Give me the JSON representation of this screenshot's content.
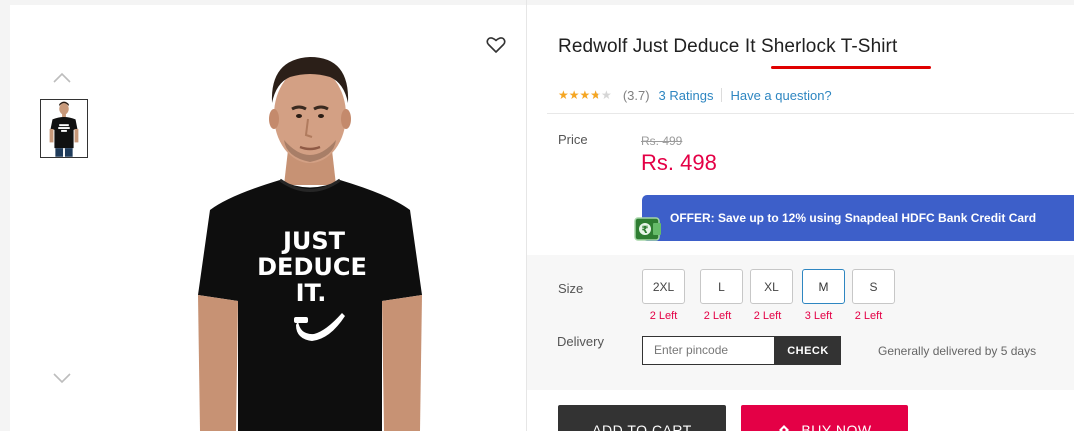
{
  "product": {
    "title": "Redwolf Just Deduce It Sherlock T-Shirt",
    "rating_value": "(3.7)",
    "rating_stars": 3.7,
    "ratings_link": "3 Ratings",
    "question_link": "Have a question?",
    "shirt_text": [
      "JUST",
      "DEDUCE",
      "IT."
    ]
  },
  "price": {
    "label": "Price",
    "mrp": "Rs. 499",
    "selling": "Rs. 498"
  },
  "offer": {
    "text": "OFFER: Save up to 12% using Snapdeal HDFC Bank Credit Card"
  },
  "size": {
    "label": "Size",
    "options": [
      {
        "label": "2XL",
        "left": "2 Left",
        "selected": false
      },
      {
        "label": "L",
        "left": "2 Left",
        "selected": false
      },
      {
        "label": "XL",
        "left": "2 Left",
        "selected": false
      },
      {
        "label": "M",
        "left": "3 Left",
        "selected": true
      },
      {
        "label": "S",
        "left": "2 Left",
        "selected": false
      }
    ]
  },
  "delivery": {
    "label": "Delivery",
    "placeholder": "Enter pincode",
    "check_label": "CHECK",
    "note": "Generally delivered by 5 days"
  },
  "actions": {
    "add_to_cart": "ADD TO CART",
    "buy_now": "BUY NOW"
  },
  "colors": {
    "accent_red": "#e40046",
    "link_blue": "#2e86c1",
    "offer_blue": "#3d5fc9",
    "star": "#f5a623"
  }
}
